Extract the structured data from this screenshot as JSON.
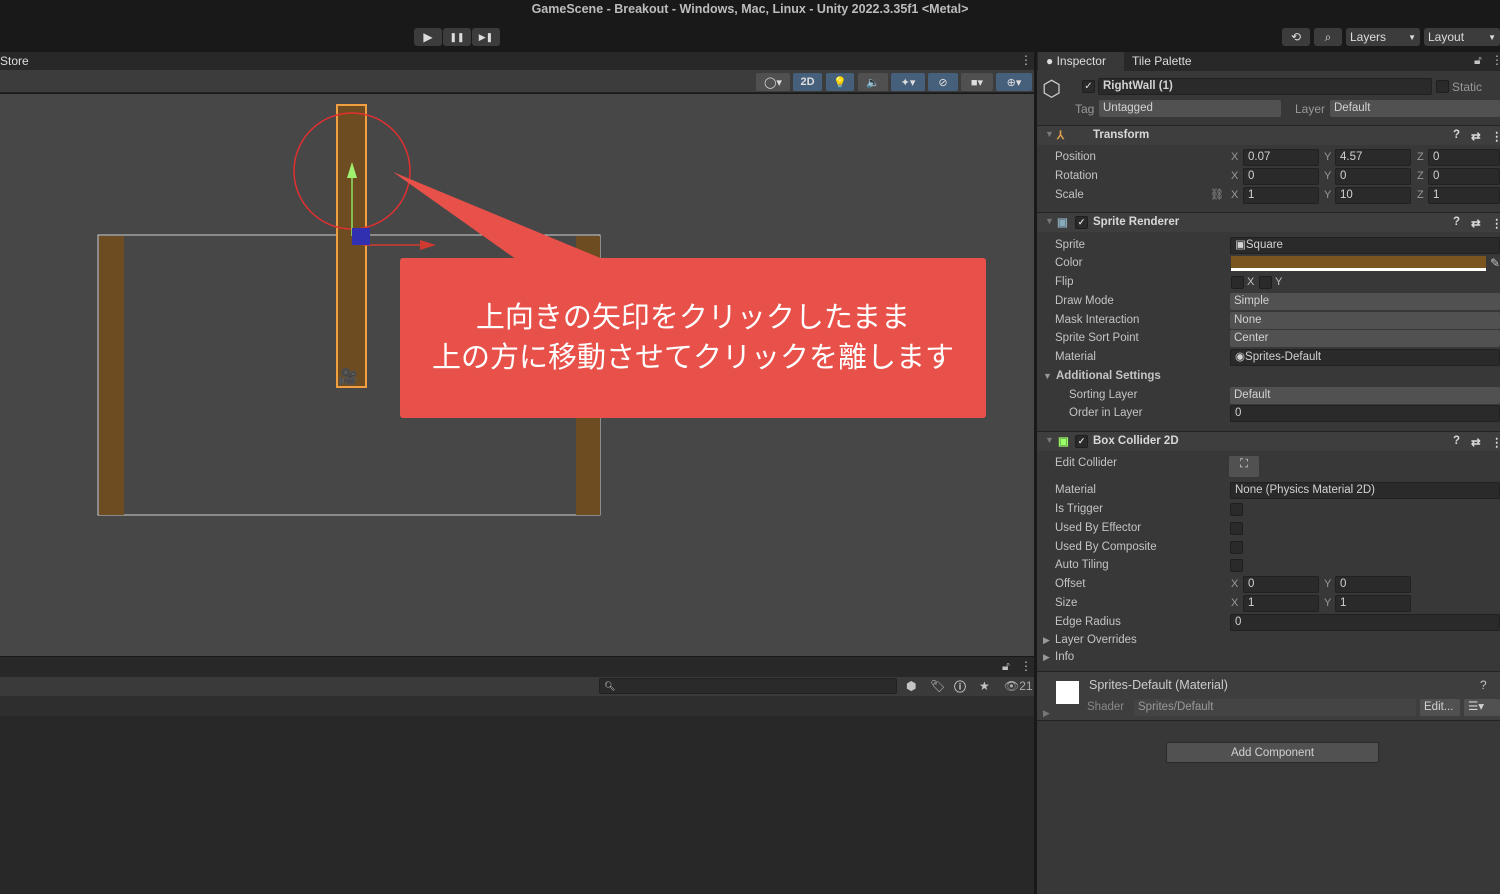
{
  "window": {
    "title": "GameScene - Breakout - Windows, Mac, Linux - Unity 2022.3.35f1 <Metal>"
  },
  "toolbar": {
    "play": "▶",
    "pause": "❚❚",
    "step": "▶❚",
    "layers": "Layers",
    "layout": "Layout"
  },
  "scene": {
    "tab_label": "Store",
    "toolbar": {
      "mode_2d": "2D"
    }
  },
  "callout": {
    "line1": "上向きの矢印をクリックしたまま",
    "line2": "上の方に移動させてクリックを離します",
    "color": "#e8504a"
  },
  "console": {
    "count": "21",
    "search_placeholder": ""
  },
  "inspector": {
    "tabs": [
      "Inspector",
      "Tile Palette"
    ],
    "object": {
      "name": "RightWall (1)",
      "static_label": "Static",
      "tag_label": "Tag",
      "tag": "Untagged",
      "layer_label": "Layer",
      "layer": "Default"
    },
    "transform": {
      "title": "Transform",
      "rows": [
        {
          "label": "Position",
          "x": "0.07",
          "y": "4.57",
          "z": "0"
        },
        {
          "label": "Rotation",
          "x": "0",
          "y": "0",
          "z": "0"
        },
        {
          "label": "Scale",
          "x": "1",
          "y": "10",
          "z": "1"
        }
      ]
    },
    "sprite_renderer": {
      "title": "Sprite Renderer",
      "sprite_label": "Sprite",
      "sprite": "Square",
      "color_label": "Color",
      "color": "#7a5520",
      "flip_label": "Flip",
      "flip_x": "X",
      "flip_y": "Y",
      "draw_mode_label": "Draw Mode",
      "draw_mode": "Simple",
      "mask_label": "Mask Interaction",
      "mask": "None",
      "sort_point_label": "Sprite Sort Point",
      "sort_point": "Center",
      "material_label": "Material",
      "material": "Sprites-Default",
      "additional": "Additional Settings",
      "sorting_layer_label": "Sorting Layer",
      "sorting_layer": "Default",
      "order_label": "Order in Layer",
      "order": "0"
    },
    "box_collider": {
      "title": "Box Collider 2D",
      "edit_label": "Edit Collider",
      "material_label": "Material",
      "material": "None (Physics Material 2D)",
      "is_trigger": "Is Trigger",
      "used_by_effector": "Used By Effector",
      "used_by_composite": "Used By Composite",
      "auto_tiling": "Auto Tiling",
      "offset_label": "Offset",
      "offset_x": "0",
      "offset_y": "0",
      "size_label": "Size",
      "size_x": "1",
      "size_y": "1",
      "edge_radius_label": "Edge Radius",
      "edge_radius": "0",
      "layer_overrides": "Layer Overrides",
      "info": "Info"
    },
    "material": {
      "title": "Sprites-Default (Material)",
      "shader_label": "Shader",
      "shader": "Sprites/Default",
      "edit": "Edit..."
    },
    "add_component": "Add Component"
  }
}
